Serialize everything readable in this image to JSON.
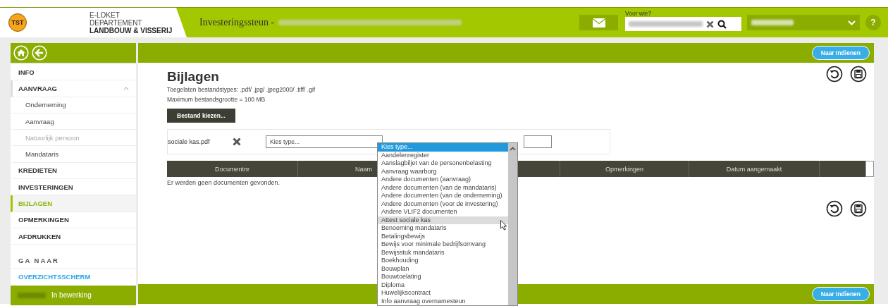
{
  "header": {
    "logo": "TST",
    "org_lines": [
      "E-LOKET",
      "DEPARTEMENT"
    ],
    "org_name": "LANDBOUW & VISSERIJ",
    "title": "Investeringssteun -",
    "search_label": "Voor wie?",
    "help": "?"
  },
  "sidebar": {
    "items": [
      {
        "label": "INFO",
        "kind": "section",
        "selected": false
      },
      {
        "label": "AANVRAAG",
        "kind": "section",
        "selected": false,
        "expanded": true
      },
      {
        "label": "Onderneming",
        "kind": "sub",
        "selected": false
      },
      {
        "label": "Aanvraag",
        "kind": "sub",
        "selected": false
      },
      {
        "label": "Natuurlijk persoon",
        "kind": "sub",
        "selected": false,
        "disabled": true
      },
      {
        "label": "Mandataris",
        "kind": "sub",
        "selected": false
      },
      {
        "label": "KREDIETEN",
        "kind": "section",
        "selected": false
      },
      {
        "label": "INVESTERINGEN",
        "kind": "section",
        "selected": false
      },
      {
        "label": "BIJLAGEN",
        "kind": "section",
        "selected": true
      },
      {
        "label": "OPMERKINGEN",
        "kind": "section",
        "selected": false
      },
      {
        "label": "AFDRUKKEN",
        "kind": "section",
        "selected": false
      },
      {
        "label": "GA NAAR",
        "kind": "heading"
      },
      {
        "label": "OVERZICHTSSCHERM",
        "kind": "link"
      }
    ],
    "status": "In bewerking"
  },
  "submit_buttons": [
    "Naar Indienen",
    "Naar Indienen"
  ],
  "page": {
    "title": "Bijlagen",
    "allowed_types": "Toegelaten bestandstypes: .pdf/ .jpg/ .jpeg2000/ .tiff/ .gif",
    "max_size": "Maximum bestandsgrootte = 100 MB",
    "choose_button": "Bestand kiezen...",
    "upload": {
      "filename": "sociale kas.pdf",
      "type_select": "Kies type..."
    },
    "table": {
      "columns": [
        "Documentnr",
        "Naam",
        "",
        "Opmerkingen",
        "Datum aangemaakt",
        ""
      ],
      "empty_message": "Er werden geen documenten gevonden."
    }
  },
  "type_dropdown": {
    "options": [
      {
        "label": "Kies type...",
        "selected": true,
        "hovered": false
      },
      {
        "label": "Aandelenregister",
        "selected": false,
        "hovered": false
      },
      {
        "label": "Aanslagbiljet van de personenbelasting",
        "selected": false,
        "hovered": false
      },
      {
        "label": "Aanvraag waarborg",
        "selected": false,
        "hovered": false
      },
      {
        "label": "Andere documenten (aanvraag)",
        "selected": false,
        "hovered": false
      },
      {
        "label": "Andere documenten (van de mandataris)",
        "selected": false,
        "hovered": false
      },
      {
        "label": "Andere documenten (van de onderneming)",
        "selected": false,
        "hovered": false
      },
      {
        "label": "Andere documenten (voor de investering)",
        "selected": false,
        "hovered": false
      },
      {
        "label": "Andere VLIF2 documenten",
        "selected": false,
        "hovered": false
      },
      {
        "label": "Attest sociale kas",
        "selected": false,
        "hovered": true
      },
      {
        "label": "Benoeming mandataris",
        "selected": false,
        "hovered": false
      },
      {
        "label": "Betalingsbewijs",
        "selected": false,
        "hovered": false
      },
      {
        "label": "Bewijs voor minimale bedrijfsomvang",
        "selected": false,
        "hovered": false
      },
      {
        "label": "Bewijsstuk mandataris",
        "selected": false,
        "hovered": false
      },
      {
        "label": "Boekhouding",
        "selected": false,
        "hovered": false
      },
      {
        "label": "Bouwplan",
        "selected": false,
        "hovered": false
      },
      {
        "label": "Bouwtoelating",
        "selected": false,
        "hovered": false
      },
      {
        "label": "Diploma",
        "selected": false,
        "hovered": false
      },
      {
        "label": "Huwelijkscontract",
        "selected": false,
        "hovered": false
      },
      {
        "label": "Info aanvraag overnamesteun",
        "selected": false,
        "hovered": false
      }
    ]
  }
}
